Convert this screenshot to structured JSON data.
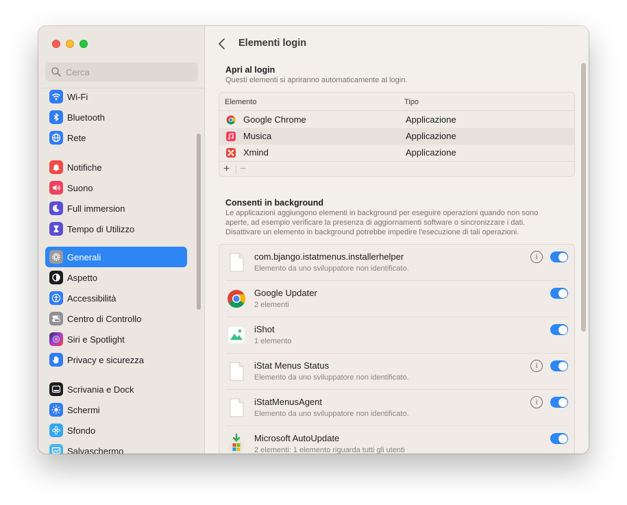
{
  "window": {
    "title": "Elementi login"
  },
  "search": {
    "placeholder": "Cerca"
  },
  "sidebar": {
    "items": [
      {
        "label": "Wi-Fi",
        "icon": "wifi-icon",
        "color": "#2f7cf6"
      },
      {
        "label": "Bluetooth",
        "icon": "bluetooth-icon",
        "color": "#2f7cf6"
      },
      {
        "label": "Rete",
        "icon": "globe-icon",
        "color": "#2f7cf6"
      },
      {
        "label": "Notifiche",
        "icon": "bell-icon",
        "color": "#f24a44"
      },
      {
        "label": "Suono",
        "icon": "speaker-icon",
        "color": "#f0405a"
      },
      {
        "label": "Full immersion",
        "icon": "moon-icon",
        "color": "#5b4dd6"
      },
      {
        "label": "Tempo di Utilizzo",
        "icon": "hourglass-icon",
        "color": "#5b4dd6"
      },
      {
        "label": "Generali",
        "icon": "gear-icon",
        "color": "#8e8e93",
        "selected": true
      },
      {
        "label": "Aspetto",
        "icon": "appearance-icon",
        "color": "#1d1d1f"
      },
      {
        "label": "Accessibilità",
        "icon": "accessibility-icon",
        "color": "#2f7cf6"
      },
      {
        "label": "Centro di Controllo",
        "icon": "toggles-icon",
        "color": "#8e8e93"
      },
      {
        "label": "Siri e Spotlight",
        "icon": "siri-icon",
        "color": "#d43bd0"
      },
      {
        "label": "Privacy e sicurezza",
        "icon": "hand-icon",
        "color": "#2f7cf6"
      },
      {
        "label": "Scrivania e Dock",
        "icon": "dock-icon",
        "color": "#1d1d1f"
      },
      {
        "label": "Schermi",
        "icon": "sun-icon",
        "color": "#2f7cf6"
      },
      {
        "label": "Sfondo",
        "icon": "flower-icon",
        "color": "#35a7f0"
      },
      {
        "label": "Salvaschermo",
        "icon": "screensaver-icon",
        "color": "#4fb4e8"
      }
    ]
  },
  "login_section": {
    "title": "Apri al login",
    "description": "Questi elementi si apriranno automaticamente al login.",
    "columns": [
      "Elemento",
      "Tipo"
    ],
    "rows": [
      {
        "name": "Google Chrome",
        "type": "Applicazione",
        "icon": "chrome-icon"
      },
      {
        "name": "Musica",
        "type": "Applicazione",
        "icon": "music-icon"
      },
      {
        "name": "Xmind",
        "type": "Applicazione",
        "icon": "xmind-icon"
      }
    ],
    "add": "+",
    "remove": "−"
  },
  "background_section": {
    "title": "Consenti in background",
    "description": [
      "Le applicazioni aggiungono elementi in background per eseguire operazioni quando non sono",
      "aperte, ad esempio verificare la presenza di aggiornamenti software o sincronizzare i dati.",
      "Disattivare un elemento in background potrebbe impedire l'esecuzione di tali operazioni."
    ],
    "items": [
      {
        "name": "com.bjango.istatmenus.installerhelper",
        "subtitle": "Elemento da uno sviluppatore non identificato.",
        "icon": "document-icon",
        "info": true,
        "enabled": true
      },
      {
        "name": "Google Updater",
        "subtitle": "2 elementi",
        "icon": "chrome-icon",
        "info": false,
        "enabled": true
      },
      {
        "name": "iShot",
        "subtitle": "1 elemento",
        "icon": "ishot-icon",
        "info": false,
        "enabled": true
      },
      {
        "name": "iStat Menus Status",
        "subtitle": "Elemento da uno sviluppatore non identificato.",
        "icon": "document-icon",
        "info": true,
        "enabled": true
      },
      {
        "name": "iStatMenusAgent",
        "subtitle": "Elemento da uno sviluppatore non identificato.",
        "icon": "document-icon",
        "info": true,
        "enabled": true
      },
      {
        "name": "Microsoft AutoUpdate",
        "subtitle": "2 elementi: 1 elemento riguarda tutti gli utenti",
        "icon": "microsoft-autoupdate-icon",
        "info": false,
        "enabled": true
      }
    ],
    "info_glyph": "i"
  },
  "colors": {
    "accent": "#2d86f3"
  }
}
